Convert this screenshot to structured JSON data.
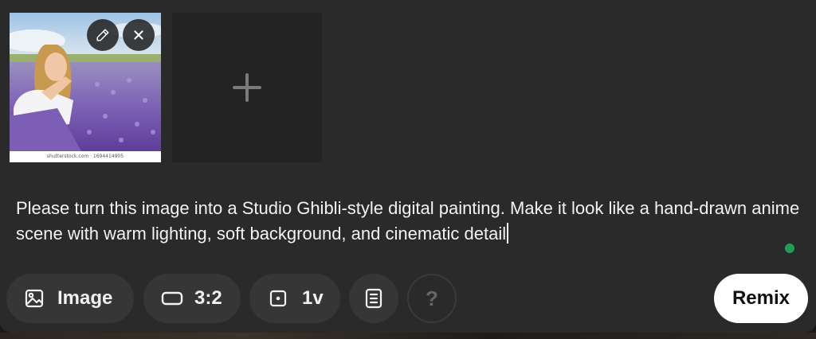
{
  "attachments": {
    "thumbnail": {
      "caption": "shutterstock.com · 1694414905",
      "edit_icon": "pencil-icon",
      "remove_icon": "close-icon"
    },
    "add_slot_icon": "plus-icon"
  },
  "prompt": {
    "text": "Please turn this image into a Studio Ghibli-style digital painting. Make it look like a hand-drawn anime scene with warm lighting, soft background, and cinematic detail"
  },
  "status": {
    "indicator_color": "#1f9d55"
  },
  "toolbar": {
    "image_label": "Image",
    "image_icon": "image-icon",
    "ratio_label": "3:2",
    "ratio_icon": "aspect-ratio-icon",
    "version_label": "1v",
    "version_icon": "square-dot-icon",
    "notes_icon": "notes-icon",
    "help_label": "?",
    "remix_label": "Remix"
  },
  "colors": {
    "panel": "#2a2a2a",
    "button": "#363636",
    "accent_button": "#ffffff"
  }
}
